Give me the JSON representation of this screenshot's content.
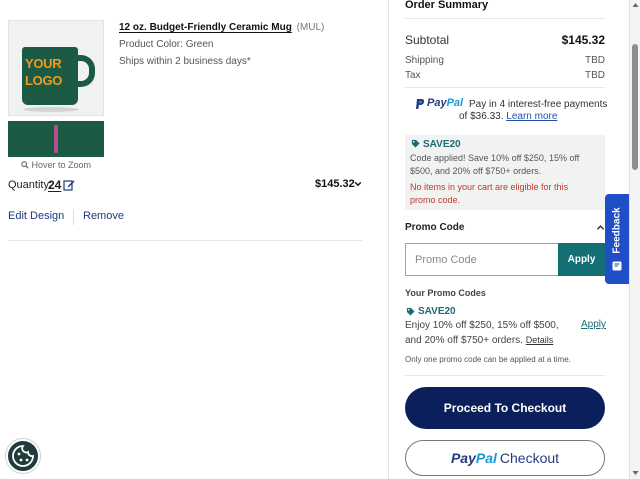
{
  "cart": {
    "section_heading_cut": "",
    "product": {
      "name": "12 oz. Budget-Friendly Ceramic Mug",
      "code": "(MUL)",
      "color_text": "Product Color: Green",
      "shipping_text": "Ships within 2 business days*",
      "mug_logo_text": "YOUR LOGO",
      "zoom_hint": "Hover to Zoom"
    },
    "quantity_label": "Quantity:",
    "quantity_value": "24",
    "price": "$145.32",
    "edit_design_label": "Edit Design",
    "remove_label": "Remove"
  },
  "summary": {
    "title": "Order Summary",
    "subtotal_label": "Subtotal",
    "subtotal_value": "$145.32",
    "shipping_label": "Shipping",
    "shipping_value": "TBD",
    "tax_label": "Tax",
    "tax_value": "TBD",
    "paypal_msg": {
      "brand_pay": "Pay",
      "brand_pal": "Pal",
      "line1": "Pay in 4 interest-free payments",
      "line2_prefix": "of $36.33.",
      "learn_more": "Learn more"
    },
    "applied_promo": {
      "code": "SAVE20",
      "description": "Code applied! Save 10% off $250, 15% off $500, and 20% off $750+ orders.",
      "error": "No items in your cart are eligible for this promo code."
    },
    "promo_code_label": "Promo Code",
    "promo_input_placeholder": "Promo Code",
    "promo_apply_label": "Apply",
    "your_codes_label": "Your Promo Codes",
    "saved_code": {
      "code": "SAVE20",
      "description": "Enjoy 10% off $250, 15% off $500, and 20% off $750+ orders.",
      "details_label": "Details",
      "apply_label": "Apply"
    },
    "only_one_note": "Only one promo code can be applied at a time.",
    "checkout_label": "Proceed To Checkout",
    "paypal_checkout": {
      "pay": "Pay",
      "pal": "Pal",
      "checkout": "Checkout"
    }
  },
  "feedback_label": "Feedback",
  "colors": {
    "accent_teal": "#136f74",
    "checkout_navy": "#0b1f5b",
    "feedback_blue": "#1f4ec7",
    "error_red": "#c0392b",
    "mug_green": "#1d5a44"
  },
  "icons": [
    "zoom-icon",
    "edit-icon",
    "chevron-down-icon",
    "tag-icon",
    "chevron-up-icon",
    "paypal-icon",
    "cookie-icon",
    "feedback-icon"
  ]
}
